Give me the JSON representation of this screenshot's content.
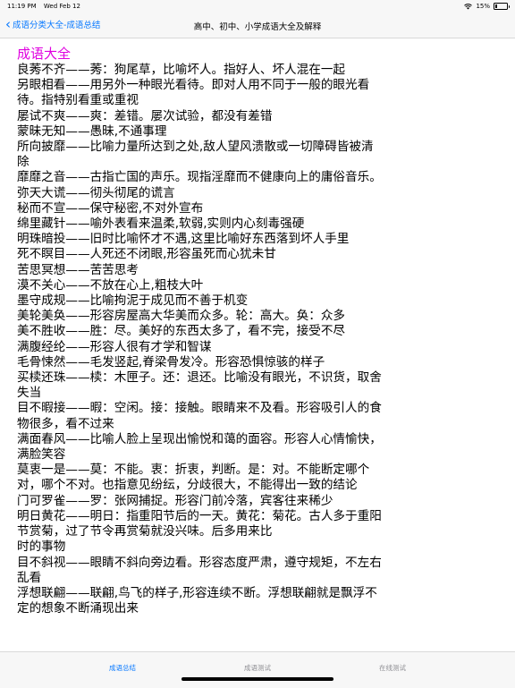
{
  "status": {
    "time": "11:19 PM",
    "date": "Wed Feb 12",
    "battery": "15%",
    "battery_level": 0.15
  },
  "nav": {
    "back_label": "成语分类大全-成语总结",
    "title": "高中、初中、小学成语大全及解释"
  },
  "content": {
    "heading": "成语大全",
    "entries": [
      {
        "term": "良莠不齐",
        "def": "莠：狗尾草，比喻坏人。指好人、坏人混在一起"
      },
      {
        "term": "另眼相看",
        "def": "用另外一种眼光看待。即对人用不同于一般的眼光看待。指特别看重或重视"
      },
      {
        "term": "屡试不爽",
        "def": "爽：差错。屡次试验，都没有差错"
      },
      {
        "term": "蒙昧无知",
        "def": "愚昧,不通事理"
      },
      {
        "term": "所向披靡",
        "def": "比喻力量所达到之处,敌人望风溃散或一切障碍皆被清除"
      },
      {
        "term": "靡靡之音",
        "def": "古指亡国的声乐。现指淫靡而不健康向上的庸俗音乐。"
      },
      {
        "term": "弥天大谎",
        "def": "彻头彻尾的谎言"
      },
      {
        "term": "秘而不宣",
        "def": "保守秘密,不对外宣布"
      },
      {
        "term": "绵里藏针",
        "def": "喻外表看来温柔,软弱,实则内心刻毒强硬"
      },
      {
        "term": "明珠暗投",
        "def": "旧时比喻怀才不遇,这里比喻好东西落到坏人手里"
      },
      {
        "term": "死不瞑目",
        "def": "人死还不闭眼,形容虽死而心犹未甘"
      },
      {
        "term": "苦思冥想",
        "def": "苦苦思考"
      },
      {
        "term": "漠不关心",
        "def": "不放在心上,粗枝大叶"
      },
      {
        "term": "墨守成规",
        "def": "比喻拘泥于成见而不善于机变"
      },
      {
        "term": "美轮美奂",
        "def": "形容房屋高大华美而众多。轮：高大。奂：众多"
      },
      {
        "term": "美不胜收",
        "def": "胜：尽。美好的东西太多了，看不完，接受不尽"
      },
      {
        "term": "满腹经纶",
        "def": "形容人很有才学和智谋"
      },
      {
        "term": "毛骨悚然",
        "def": "毛发竖起,脊梁骨发冷。形容恐惧惊骇的样子"
      },
      {
        "term": "买椟还珠",
        "def": "椟：木匣子。还：退还。比喻没有眼光，不识货，取舍失当"
      },
      {
        "term": "目不暇接",
        "def": "暇：空闲。接：接触。眼睛来不及看。形容吸引人的食物很多，看不过来"
      },
      {
        "term": "满面春风",
        "def": "比喻人脸上呈现出愉悦和蔼的面容。形容人心情愉快，满脸笑容"
      },
      {
        "term": "莫衷一是",
        "def": "莫：不能。衷：折衷，判断。是：对。不能断定哪个对，哪个不对。也指意见纷纭，分歧很大，不能得出一致的结论"
      },
      {
        "term": "门可罗雀",
        "def": "罗：张网捕捉。形容门前冷落，宾客往来稀少"
      },
      {
        "term": "明日黄花",
        "def": "明日：指重阳节后的一天。黄花：菊花。古人多于重阳节赏菊，过了节令再赏菊就没兴味。后多用来比"
      },
      {
        "term": "",
        "def": "时的事物"
      },
      {
        "term": "目不斜视",
        "def": "眼睛不斜向旁边看。形容态度严肃，遵守规矩，不左右乱看"
      },
      {
        "term": "浮想联翩",
        "def": "联翩,鸟飞的样子,形容连续不断。浮想联翩就是飘浮不定的想象不断涌现出来"
      }
    ],
    "separator": "——"
  },
  "tabs": [
    {
      "label": "成语总结",
      "active": true
    },
    {
      "label": "成语测试",
      "active": false
    },
    {
      "label": "在线测试",
      "active": false
    }
  ]
}
